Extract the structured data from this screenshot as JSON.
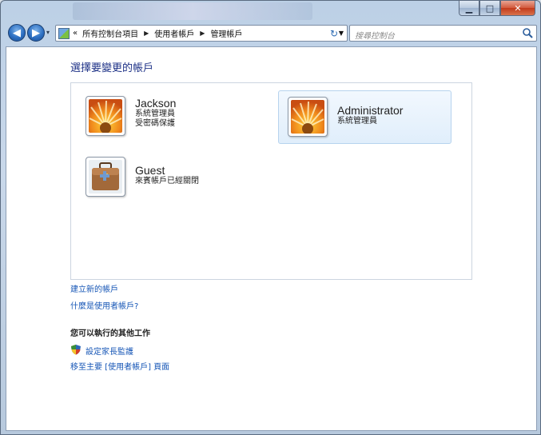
{
  "window": {
    "minimize_glyph": "▁",
    "maximize_glyph": "□",
    "close_glyph": "✕"
  },
  "navigation": {
    "back_glyph": "◀",
    "forward_glyph": "▶",
    "recent_glyph": "▾",
    "chevron": "«",
    "breadcrumb": [
      "所有控制台項目",
      "使用者帳戶",
      "管理帳戶"
    ],
    "refresh_glyph": "↻",
    "search_placeholder": "搜尋控制台"
  },
  "main": {
    "title": "選擇要變更的帳戶",
    "accounts": [
      {
        "name": "Jackson",
        "lines": [
          "系統管理員",
          "受密碼保護"
        ],
        "picture": "flower-icon",
        "selected": false
      },
      {
        "name": "Administrator",
        "lines": [
          "系統管理員"
        ],
        "picture": "flower-icon",
        "selected": true
      },
      {
        "name": "Guest",
        "lines": [
          "來賓帳戶已經關閉"
        ],
        "picture": "briefcase-icon",
        "selected": false
      }
    ],
    "links": {
      "create_account": "建立新的帳戶",
      "what_is_account": "什麼是使用者帳戶?"
    },
    "other_tasks": {
      "heading": "您可以執行的其他工作",
      "parental_controls": "設定家長監護",
      "go_main_page": "移至主要 [使用者帳戶] 頁面"
    }
  },
  "colors": {
    "link": "#1656b6",
    "title": "#1e3287",
    "selected_bg": "#e0eefb"
  }
}
